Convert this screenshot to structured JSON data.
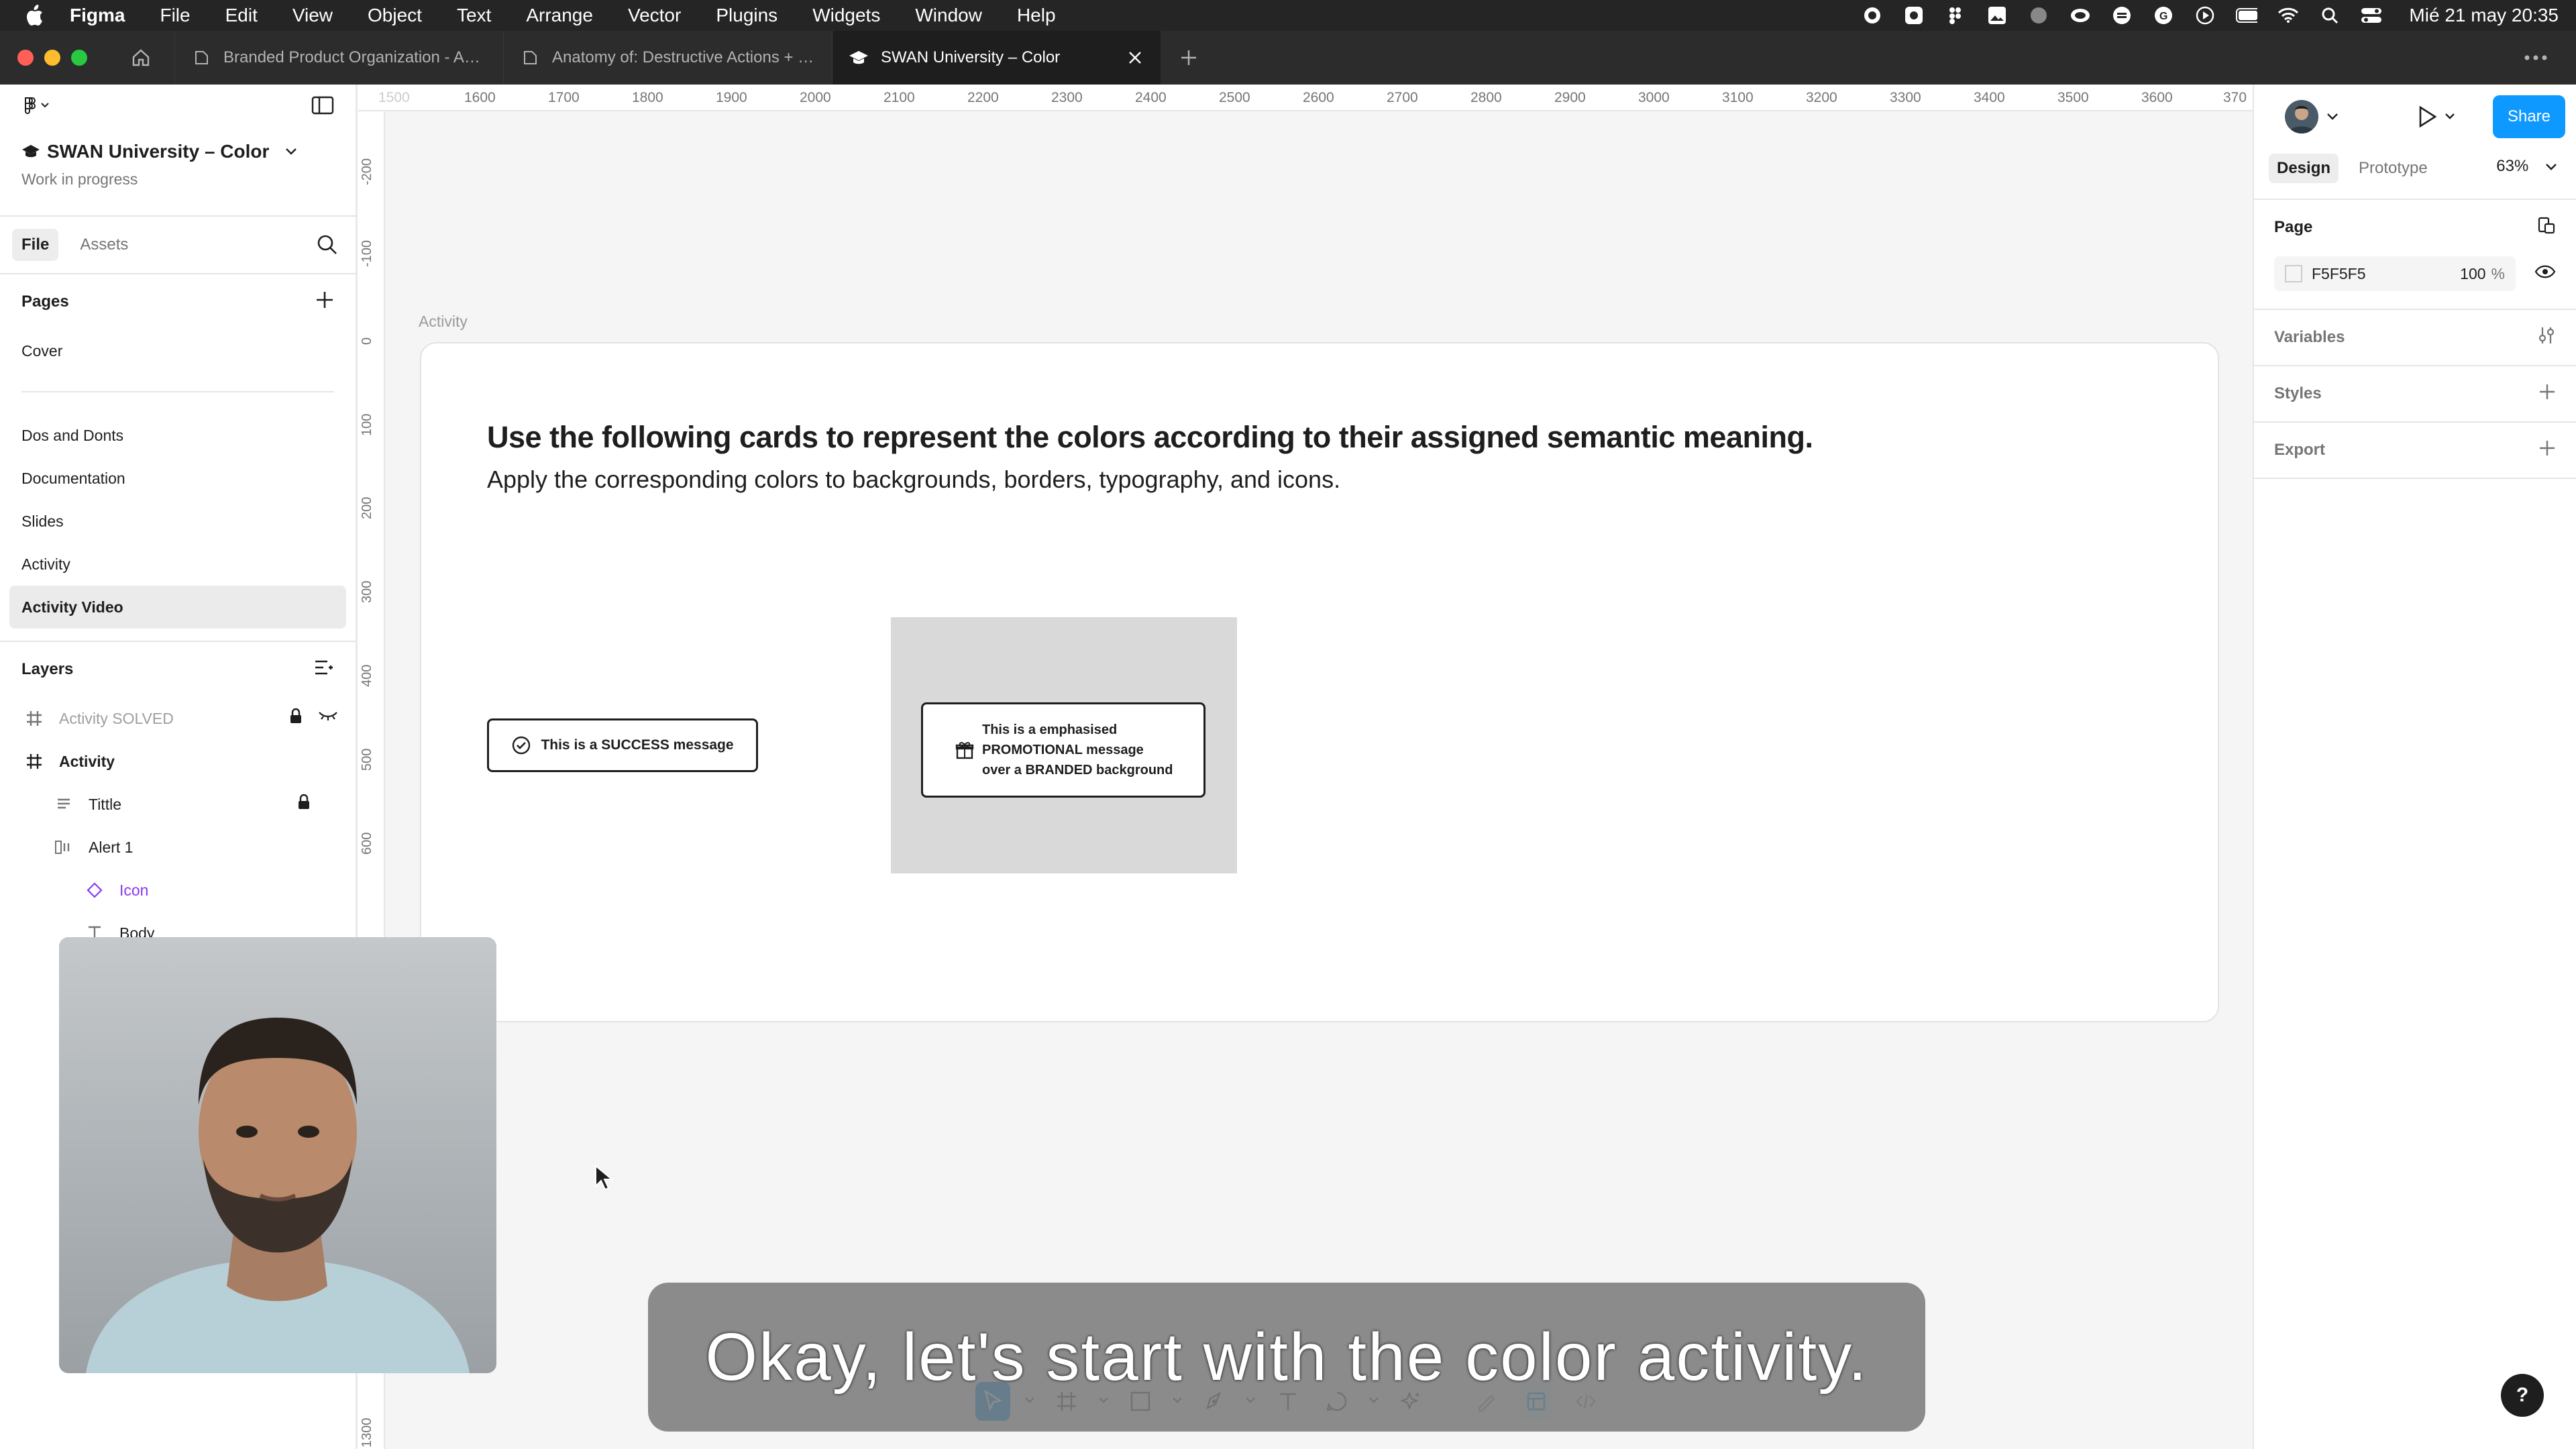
{
  "menubar": {
    "app": "Figma",
    "menus": [
      "File",
      "Edit",
      "View",
      "Object",
      "Text",
      "Arrange",
      "Vector",
      "Plugins",
      "Widgets",
      "Window",
      "Help"
    ],
    "clock": "Mié 21 may 20:35"
  },
  "tabs": [
    {
      "label": "Branded Product Organization - Admi",
      "icon": "figma-file-icon"
    },
    {
      "label": "Anatomy of: Destructive Actions + Bu",
      "icon": "figma-file-icon"
    },
    {
      "label": "SWAN University – Color",
      "icon": "graduation-cap-icon",
      "active": true
    }
  ],
  "file": {
    "name": "SWAN University – Color",
    "status": "Work in progress"
  },
  "left_tabs": {
    "file": "File",
    "assets": "Assets"
  },
  "pages": {
    "title": "Pages",
    "items": [
      "Cover",
      "Dos and Donts",
      "Documentation",
      "Slides",
      "Activity",
      "Activity Video"
    ],
    "selected": "Activity Video"
  },
  "layers": {
    "title": "Layers",
    "items": [
      {
        "label": "Activity SOLVED",
        "icon": "frame-icon"
      },
      {
        "label": "Activity",
        "icon": "frame-icon"
      },
      {
        "label": "Tittle",
        "icon": "text-frame-icon"
      },
      {
        "label": "Alert 1",
        "icon": "auto-layout-icon"
      },
      {
        "label": "Icon",
        "icon": "instance-icon"
      },
      {
        "label": "Body",
        "icon": "text-icon"
      }
    ]
  },
  "ruler": {
    "top": [
      "1500",
      "1600",
      "1700",
      "1800",
      "1900",
      "2000",
      "2100",
      "2200",
      "2300",
      "2400",
      "2500",
      "2600",
      "2700",
      "2800",
      "2900",
      "3000",
      "3100",
      "3200",
      "3300",
      "3400",
      "3500",
      "3600",
      "370"
    ],
    "left": [
      "-200",
      "-100",
      "0",
      "100",
      "200",
      "300",
      "400",
      "500",
      "600",
      "1300"
    ]
  },
  "canvas": {
    "frame_label": "Activity",
    "heading": "Use the following cards to represent the colors according to their assigned semantic meaning.",
    "subheading": "Apply the corresponding colors to backgrounds, borders, typography, and icons.",
    "success_alert": "This is a SUCCESS message",
    "promo_lines": [
      "This is a emphasised",
      "PROMOTIONAL message",
      "over a BRANDED background"
    ]
  },
  "right_panel": {
    "share": "Share",
    "tabs": {
      "design": "Design",
      "prototype": "Prototype"
    },
    "zoom": "63%",
    "page_section": "Page",
    "page_color": "F5F5F5",
    "page_opacity": "100",
    "percent": "%",
    "variables": "Variables",
    "styles": "Styles",
    "export": "Export"
  },
  "subtitle": "Okay, let's start with the color activity.",
  "help": "?",
  "colors": {
    "accent": "#0d99ff",
    "component": "#8a38f5",
    "canvas": "#f5f5f5"
  }
}
